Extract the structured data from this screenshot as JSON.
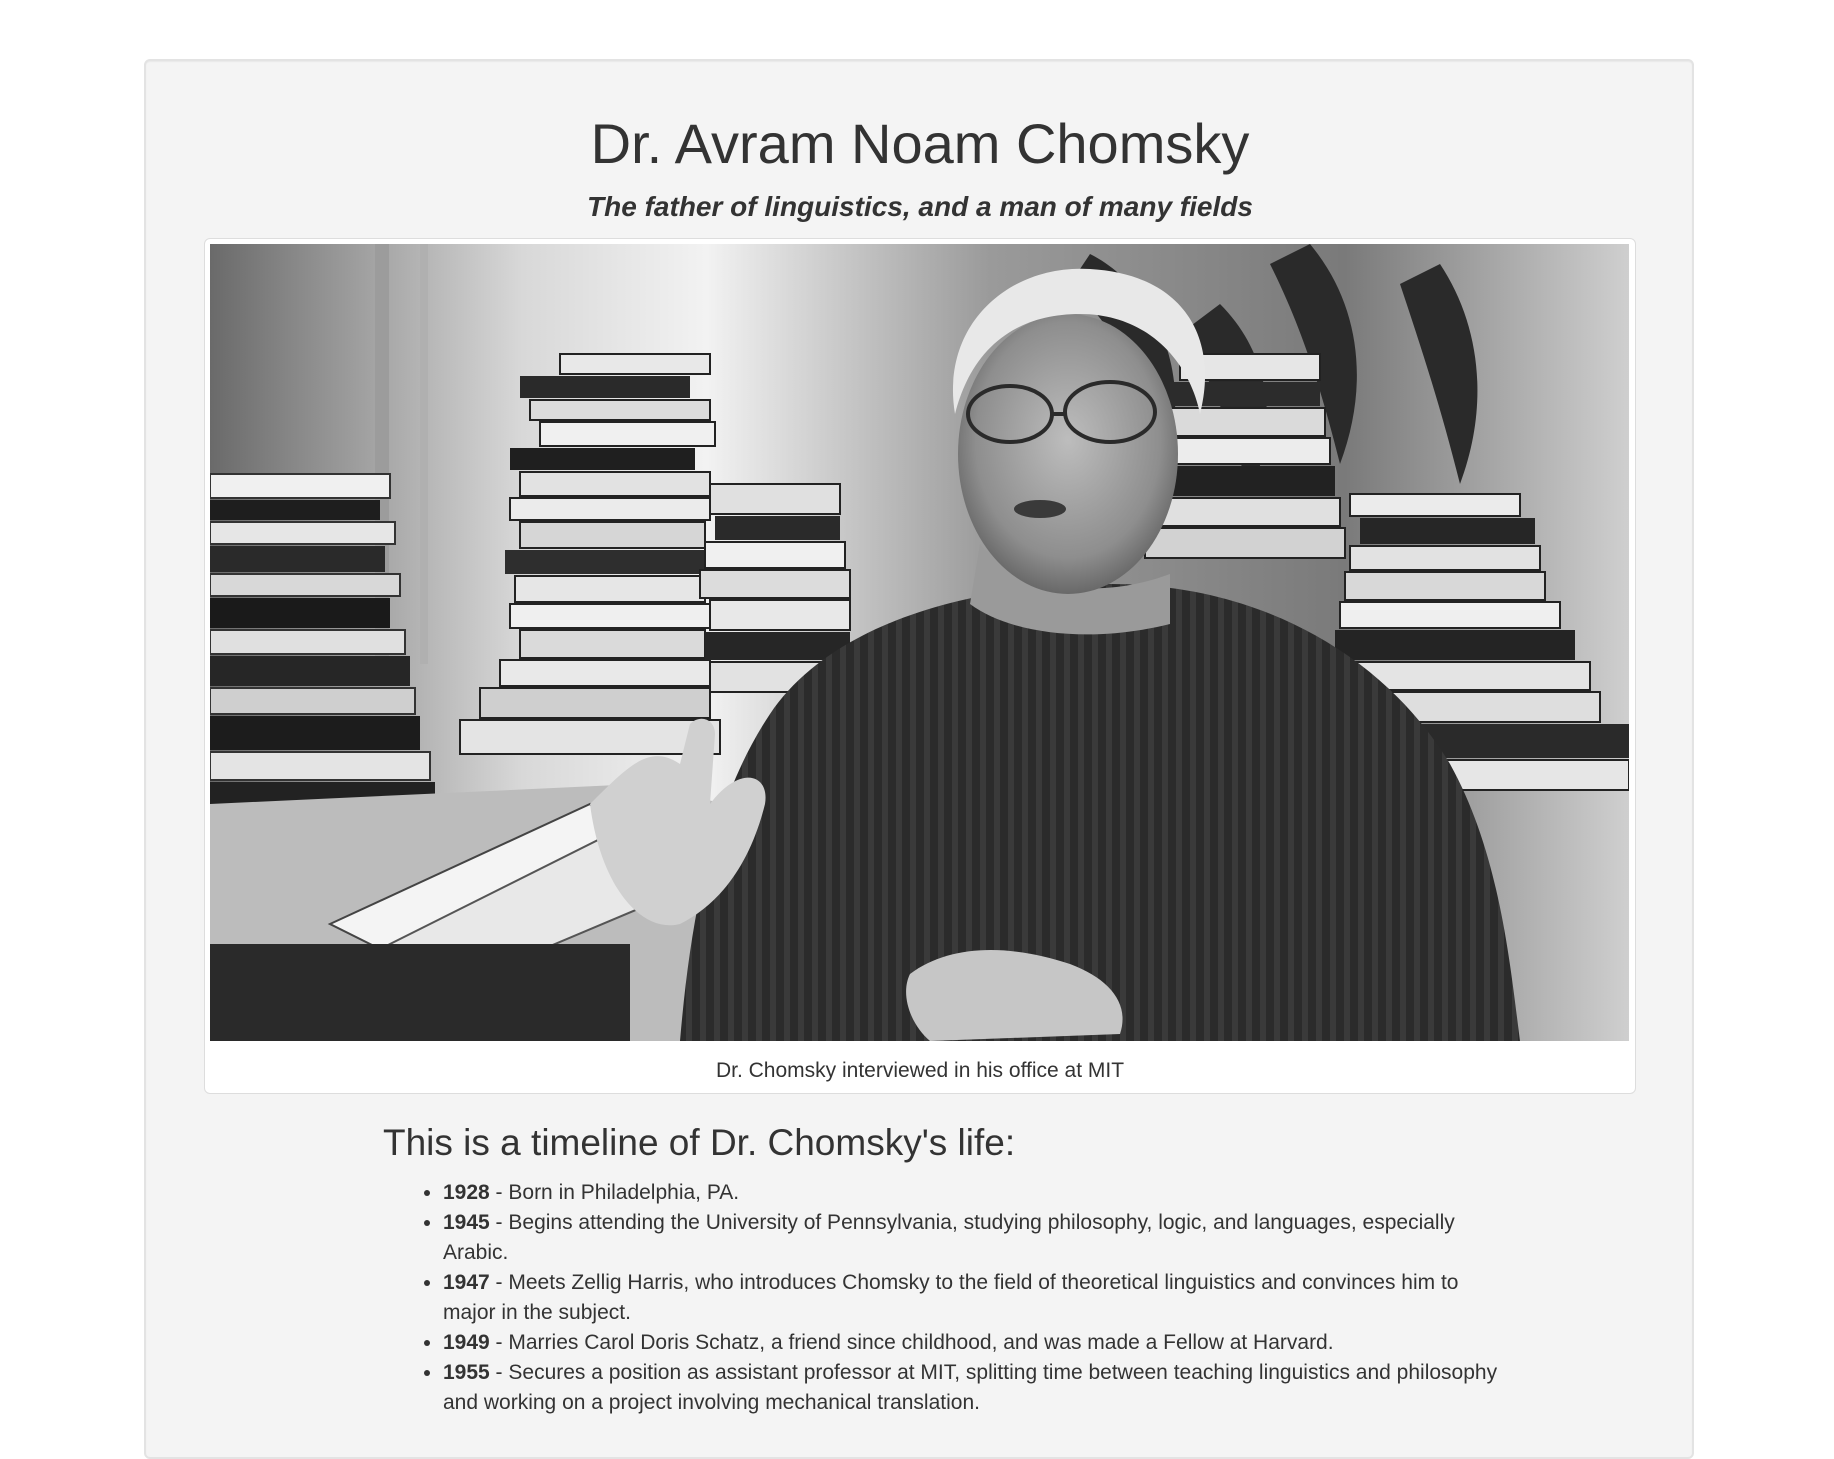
{
  "header": {
    "title": "Dr. Avram Noam Chomsky",
    "subtitle": "The father of linguistics, and a man of many fields"
  },
  "image": {
    "caption": "Dr. Chomsky interviewed in his office at MIT",
    "alt": "Black and white photo of Dr. Chomsky sitting among stacks of books",
    "tone": "grayscale"
  },
  "timeline": {
    "heading": "This is a timeline of Dr. Chomsky's life:",
    "items": [
      {
        "year": "1928",
        "text": " - Born in Philadelphia, PA."
      },
      {
        "year": "1945",
        "text": " - Begins attending the University of Pennsylvania, studying philosophy, logic, and languages, especially Arabic."
      },
      {
        "year": "1947",
        "text": " - Meets Zellig Harris, who introduces Chomsky to the field of theoretical linguistics and convinces him to major in the subject."
      },
      {
        "year": "1949",
        "text": " - Marries Carol Doris Schatz, a friend since childhood, and was made a Fellow at Harvard."
      },
      {
        "year": "1955",
        "text": " - Secures a position as assistant professor at MIT, splitting time between teaching linguistics and philosophy and working on a project involving mechanical translation."
      }
    ]
  },
  "colors": {
    "well_background": "#f4f4f4",
    "text": "#333333",
    "border": "#dddddd"
  }
}
